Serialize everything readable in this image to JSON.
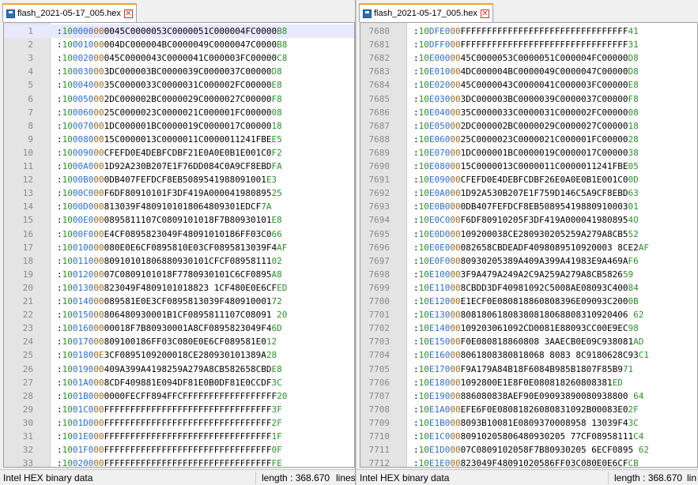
{
  "colors": {
    "length_field": "#2c8f2c",
    "address_field": "#2c6fd0",
    "type_field": "#9a6a20",
    "checksum_field": "#2c8f2c",
    "line_numbers": "#8a8a8a",
    "active_tab_accent": "#f3a52a"
  },
  "icons": {
    "file": "save-icon",
    "close": "close-icon"
  },
  "left": {
    "tab_title": "flash_2021-05-17_005.hex",
    "current_line": 1,
    "rows": [
      {
        "n": "1",
        "rec": ":100000000045C0000053C0000051C000004FC0000B8"
      },
      {
        "n": "2",
        "rec": ":10001000004DC000004BC0000049C0000047C0000B8"
      },
      {
        "n": "3",
        "rec": ":10002000045C0000043C0000041C000003FC00000C8"
      },
      {
        "n": "4",
        "rec": ":100030003DC000003BC0000039C0000037C00000D8"
      },
      {
        "n": "5",
        "rec": ":1000400035C0000033C0000031C000002FC00000E8"
      },
      {
        "n": "6",
        "rec": ":100050002DC000002BC0000029C0000027C00000F8"
      },
      {
        "n": "7",
        "rec": ":1000600025C0000023C0000021C000001FC0000008"
      },
      {
        "n": "8",
        "rec": ":100070001DC000001BC0000019C0000017C0000018"
      },
      {
        "n": "9",
        "rec": ":1000800015C0000013C0000011C0000011241FBEE5"
      },
      {
        "n": "10",
        "rec": ":10009000CFEFD0E4DEBFCDBF21E0A0E0B1E001C0F2"
      },
      {
        "n": "11",
        "rec": ":1000A0001D92A230B207E1F76DD084C0A9CF8EBDFA"
      },
      {
        "n": "12",
        "rec": ":1000B0000DB407FEFDCF8EB5089541988091001E3"
      },
      {
        "n": "13",
        "rec": ":1000C000F6DF80910101F3DF419A00004198089525"
      },
      {
        "n": "14",
        "rec": ":1000D000813039F4809101018064809301EDCF7A"
      },
      {
        "n": "15",
        "rec": ":1000E0000895811107C0809101018F7B80930101E8"
      },
      {
        "n": "16",
        "rec": ":1000F000E4CF0895823049F48091010186FF03C066"
      },
      {
        "n": "17",
        "rec": ":10010000080E0E6CF0895810E03CF0895813039F4AF"
      },
      {
        "n": "18",
        "rec": ":1001100080910101806880930101CFCF0895811102"
      },
      {
        "n": "19",
        "rec": ":1001200007C0809101018F7780930101C6CF0895A8"
      },
      {
        "n": "20",
        "rec": ":10013000823049F4809101018823 1CF480E0E6CFED"
      },
      {
        "n": "21",
        "rec": ":10014000089581E0E3CF0895813039F48091000172"
      },
      {
        "n": "22",
        "rec": ":10015000806480930001B1CF0895811107C08091 20"
      },
      {
        "n": "23",
        "rec": ":1001600000018F7B80930001A8CF0895823049F46D"
      },
      {
        "n": "24",
        "rec": ":10017000809100186FF03C080E0E6CF089581E012"
      },
      {
        "n": "25",
        "rec": ":1001800E3CF0895109200018CE280930101389A28"
      },
      {
        "n": "26",
        "rec": ":10019000409A399A4198259A279A8CB582658CBDE8"
      },
      {
        "n": "27",
        "rec": ":1001A0008CDF409881E094DF81E0B0DF81E0CCDF3C"
      },
      {
        "n": "28",
        "rec": ":1001B0000000FECFF894FFCFFFFFFFFFFFFFFFFFF20"
      },
      {
        "n": "29",
        "rec": ":1001C000FFFFFFFFFFFFFFFFFFFFFFFFFFFFFFFF3F"
      },
      {
        "n": "30",
        "rec": ":1001D000FFFFFFFFFFFFFFFFFFFFFFFFFFFFFFFF2F"
      },
      {
        "n": "31",
        "rec": ":1001E000FFFFFFFFFFFFFFFFFFFFFFFFFFFFFFFF1F"
      },
      {
        "n": "32",
        "rec": ":1001F000FFFFFFFFFFFFFFFFFFFFFFFFFFFFFFFF0F"
      },
      {
        "n": "33",
        "rec": ":10020000FFFFFFFFFFFFFFFFFFFFFFFFFFFFFFFFFE"
      }
    ],
    "status_type": "Intel HEX binary data",
    "status_length": "length : 368.670",
    "status_lines": "lines"
  },
  "right": {
    "tab_title": "flash_2021-05-17_005.hex",
    "rows": [
      {
        "n": "7680",
        "rec": ":10DFE000FFFFFFFFFFFFFFFFFFFFFFFFFFFFFFFF41"
      },
      {
        "n": "7681",
        "rec": ":10DFF000FFFFFFFFFFFFFFFFFFFFFFFFFFFFFFFF31"
      },
      {
        "n": "7682",
        "rec": ":10E0000045C0000053C0000051C000004FC00000D8"
      },
      {
        "n": "7683",
        "rec": ":10E010004DC000004BC0000049C0000047C00000D8"
      },
      {
        "n": "7684",
        "rec": ":10E0200045C0000043C0000041C000003FC00000E8"
      },
      {
        "n": "7685",
        "rec": ":10E030003DC000003BC0000039C0000037C00000F8"
      },
      {
        "n": "7686",
        "rec": ":10E0400035C0000033C0000031C000002FC0000008"
      },
      {
        "n": "7687",
        "rec": ":10E050002DC000002BC0000029C0000027C0000018"
      },
      {
        "n": "7688",
        "rec": ":10E0600025C0000023C0000021C000001FC0000028"
      },
      {
        "n": "7689",
        "rec": ":10E070001DC000001BC0000019C0000017C0000038"
      },
      {
        "n": "7690",
        "rec": ":10E0800015C0000013C0000011C0000011241FBE05"
      },
      {
        "n": "7691",
        "rec": ":10E09000CFEFD0E4DEBFCDBF26E0A0E0B1E001C00D"
      },
      {
        "n": "7692",
        "rec": ":10E0A0001D92A530B207E1F759D146C5A9CF8EBD63"
      },
      {
        "n": "7693",
        "rec": ":10E0B0000DB407FEFDCF8EB5089541988091000301"
      },
      {
        "n": "7694",
        "rec": ":10E0C000F6DF80910205F3DF419A0000419808954O"
      },
      {
        "n": "7695",
        "rec": ":10E0D000109200038CE280930205259A279A8CB552"
      },
      {
        "n": "7696",
        "rec": ":10E0E000082658CBDEADF4098089510920003 8CE2AF"
      },
      {
        "n": "7697",
        "rec": ":10E0F00080930205389A409A399A41983E9A469AF6"
      },
      {
        "n": "7698",
        "rec": ":10E100003F9A479A249A2C9A259A279A8CB582659"
      },
      {
        "n": "7699",
        "rec": ":10E110008CBDD3DF40981092C5008AE08093C40084"
      },
      {
        "n": "7700",
        "rec": ":10E12000E1ECF0E080818860808396E09093C2000B"
      },
      {
        "n": "7701",
        "rec": ":10E1300080818061808380818068808310920406 62"
      },
      {
        "n": "7702",
        "rec": ":10E14000109203061092CD0081E88093CC00E9EC98"
      },
      {
        "n": "7703",
        "rec": ":10E15000F0E080818860808 3AAECB0E09C938081AD"
      },
      {
        "n": "7704",
        "rec": ":10E160008061808380818068 8083 8C9180628C93C1"
      },
      {
        "n": "7705",
        "rec": ":10E17000F9A179A84B18F6084B985B1807F85B971"
      },
      {
        "n": "7706",
        "rec": ":10E180001092800E1E8F0E080818260808381ED"
      },
      {
        "n": "7707",
        "rec": ":10E19000886080838AEF90E09093890080938800 64"
      },
      {
        "n": "7708",
        "rec": ":10E1A000EFE6F0E08081826080831092B00083E02F"
      },
      {
        "n": "7709",
        "rec": ":10E1B0008093B10081E0809370008958 13039F43C"
      },
      {
        "n": "7710",
        "rec": ":10E1C00080910205806480930205 77CF08958111C4"
      },
      {
        "n": "7711",
        "rec": ":10E1D00007C0809102058F7B80930205 6ECF0895 62"
      },
      {
        "n": "7712",
        "rec": ":10E1E000823049F48091020586FF03C080E0E6CFCB"
      }
    ],
    "status_type": "Intel HEX binary data",
    "status_length": "length : 368.670",
    "status_lines": "lin"
  }
}
